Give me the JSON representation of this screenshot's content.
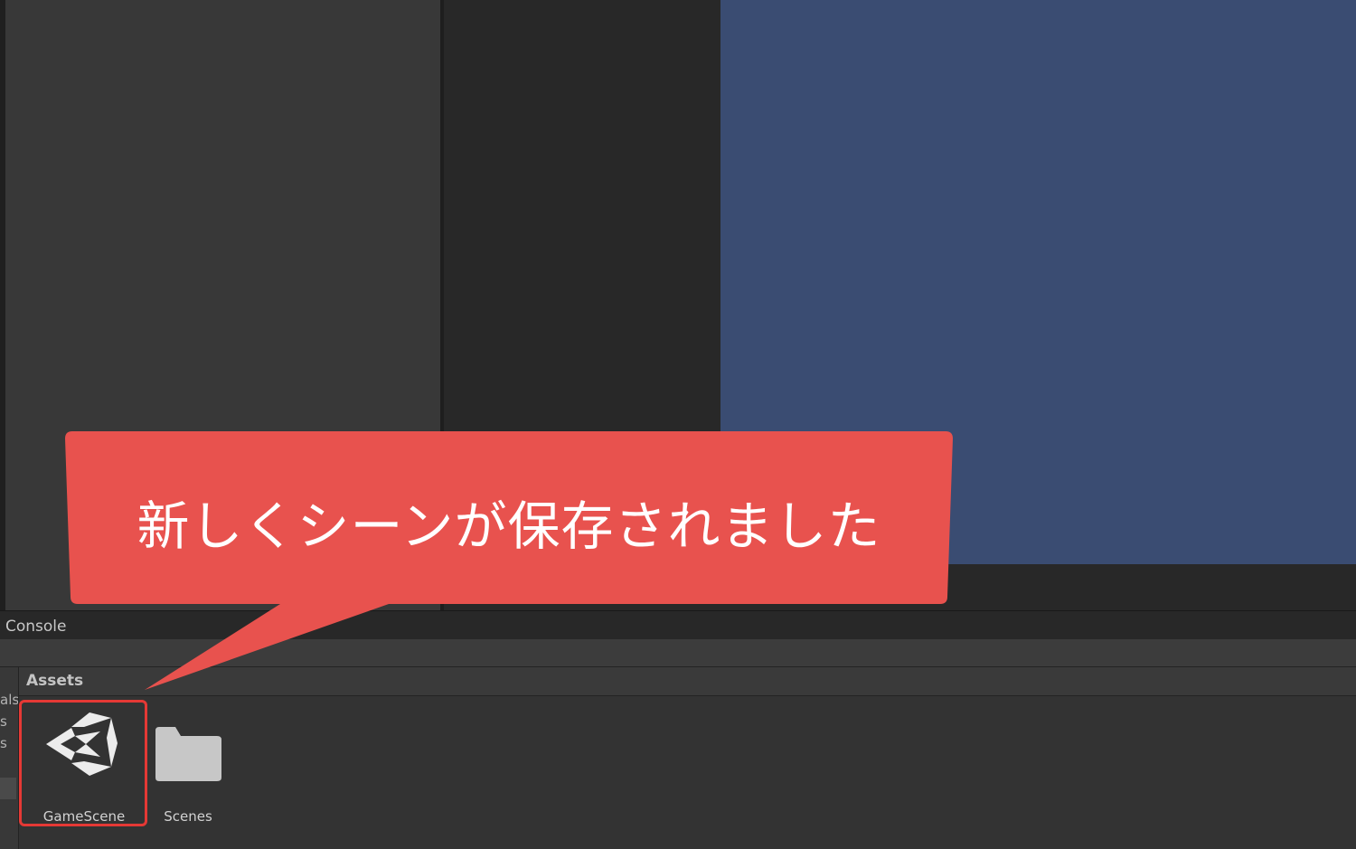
{
  "panels": {
    "bottom_tab": "Console",
    "breadcrumb": "Assets"
  },
  "sidebar": {
    "fragments": [
      "als",
      "s",
      "s"
    ]
  },
  "assets": [
    {
      "label": "GameScene",
      "icon": "unity-scene-icon"
    },
    {
      "label": "Scenes",
      "icon": "folder-icon"
    }
  ],
  "callout": {
    "text": "新しくシーンが保存されました"
  },
  "colors": {
    "game_view": "#3a4c72",
    "callout": "#e8524e",
    "highlight": "#e53935"
  }
}
